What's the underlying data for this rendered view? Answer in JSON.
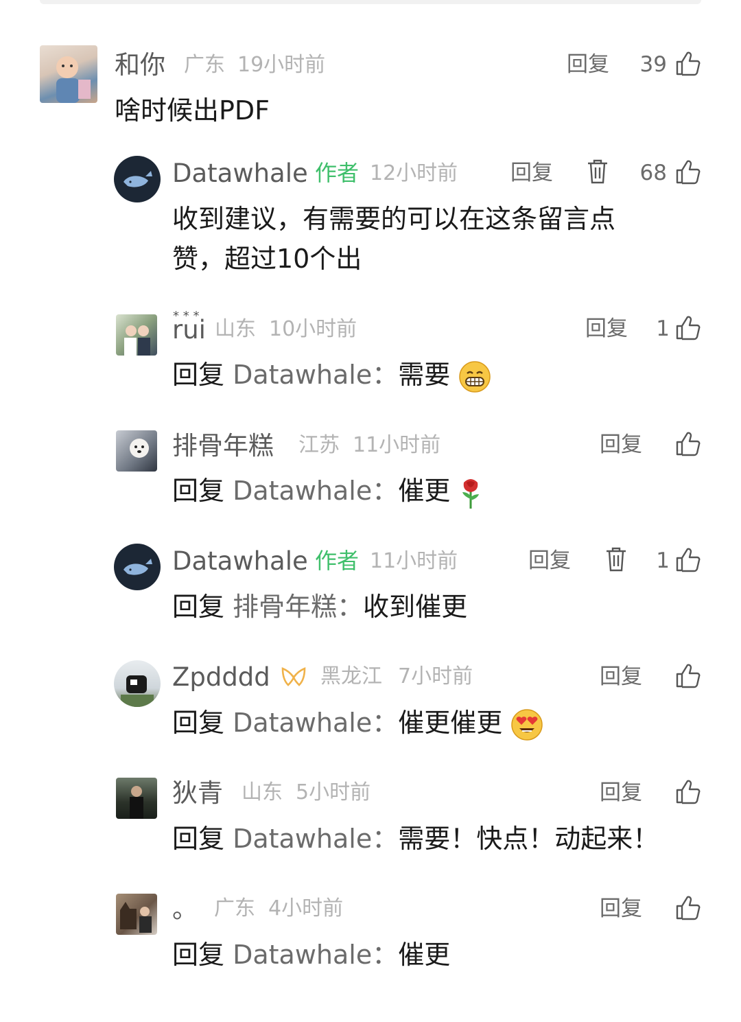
{
  "comments": [
    {
      "name": "和你",
      "location": "广东",
      "time": "19小时前",
      "reply_label": "回复",
      "likes": "39",
      "text": "啥时候出PDF",
      "avatar": "baby-photo-avatar"
    },
    {
      "name": "Datawhale",
      "badge": "作者",
      "time": "12小时前",
      "reply_label": "回复",
      "likes": "68",
      "text_line1": "收到建议，有需要的可以在这条留言点",
      "text_line2": "赞，超过10个出",
      "avatar": "whale-logo-avatar"
    },
    {
      "name": "rui",
      "name_deco": "* * *",
      "location": "山东",
      "time": "10小时前",
      "reply_label": "回复",
      "likes": "1",
      "reply_prefix": "回复",
      "reply_target": "Datawhale",
      "reply_sep": "：",
      "text": "需要",
      "emoji": "grinning-face-emoji",
      "avatar": "couple-photo-avatar"
    },
    {
      "name": "排骨年糕",
      "location": "江苏",
      "time": "11小时前",
      "reply_label": "回复",
      "likes": "",
      "reply_prefix": "回复",
      "reply_target": "Datawhale",
      "reply_sep": "：",
      "text": "催更",
      "emoji": "rose-emoji",
      "avatar": "dog-photo-avatar"
    },
    {
      "name": "Datawhale",
      "badge": "作者",
      "time": "11小时前",
      "reply_label": "回复",
      "likes": "1",
      "reply_prefix": "回复",
      "reply_target": "排骨年糕",
      "reply_sep": "：",
      "text": "收到催更",
      "avatar": "whale-logo-avatar"
    },
    {
      "name": "Zpdddd",
      "location": "黑龙江",
      "time": "7小时前",
      "reply_label": "回复",
      "likes": "",
      "reply_prefix": "回复",
      "reply_target": "Datawhale",
      "reply_sep": "：",
      "text": "催更催更",
      "emoji": "heart-eyes-emoji",
      "avatar": "cow-photo-avatar"
    },
    {
      "name": "狄青",
      "location": "山东",
      "time": "5小时前",
      "reply_label": "回复",
      "likes": "",
      "reply_prefix": "回复",
      "reply_target": "Datawhale",
      "reply_sep": "：",
      "text": "需要！快点！动起来！",
      "avatar": "person-photo-avatar"
    },
    {
      "name": "。",
      "location": "广东",
      "time": "4小时前",
      "reply_label": "回复",
      "likes": "",
      "reply_prefix": "回复",
      "reply_target": "Datawhale",
      "reply_sep": "：",
      "text": "催更",
      "avatar": "dog-man-photo-avatar"
    }
  ],
  "colors": {
    "author_badge": "#3fbf6b",
    "meta": "#b3b3b3",
    "name": "#5b5b5b",
    "body": "#1a1a1a"
  }
}
